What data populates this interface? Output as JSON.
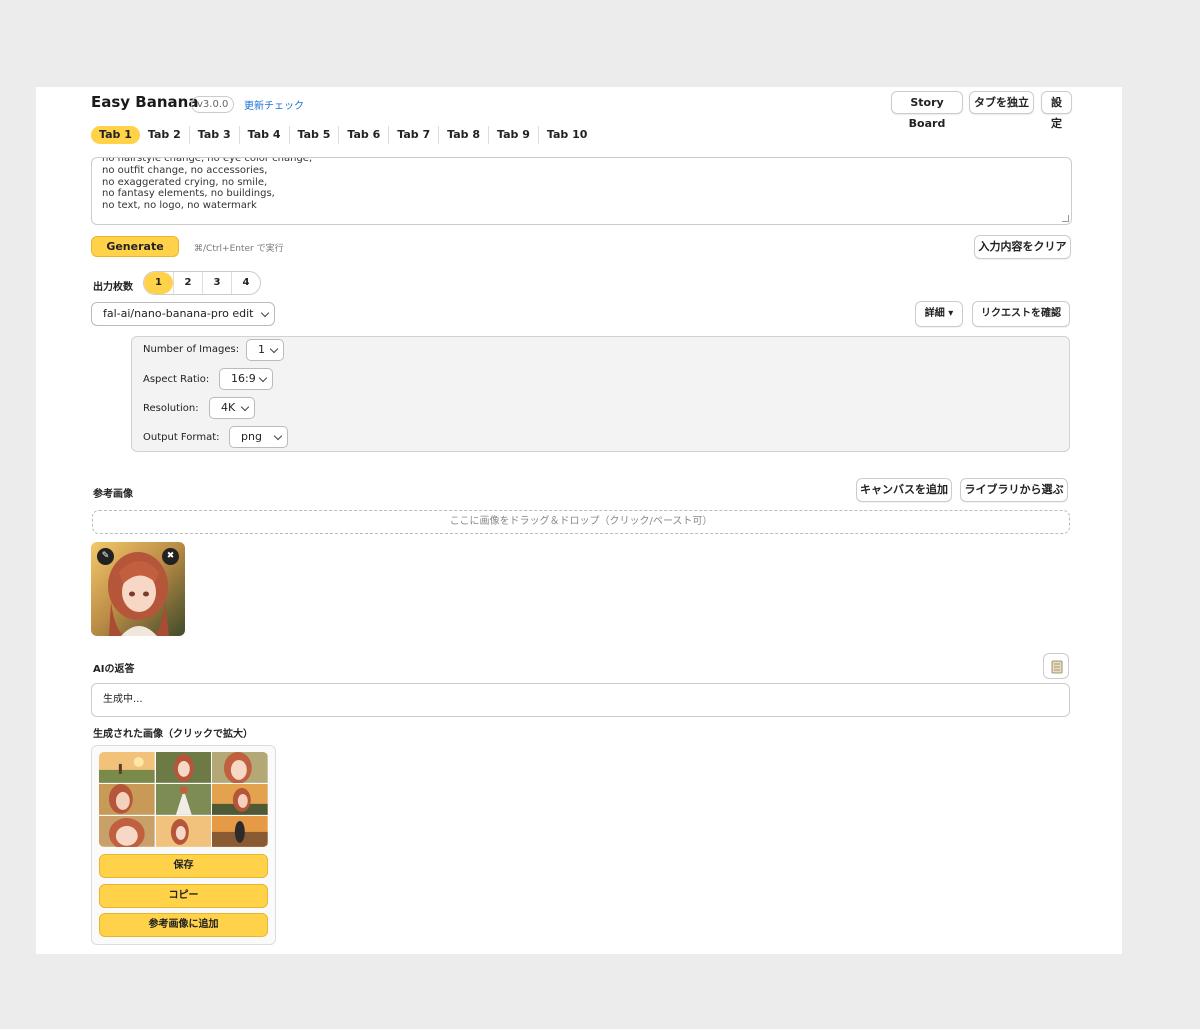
{
  "header": {
    "title": "Easy Banana",
    "version": "v3.0.0",
    "update_check": "更新チェック",
    "story_board": "Story Board",
    "detach_tab": "タブを独立",
    "settings": "設定"
  },
  "tabs": [
    "Tab 1",
    "Tab 2",
    "Tab 3",
    "Tab 4",
    "Tab 5",
    "Tab 6",
    "Tab 7",
    "Tab 8",
    "Tab 9",
    "Tab 10"
  ],
  "prompt": {
    "text": "no hairstyle change, no eye color change,\nno outfit change, no accessories,\nno exaggerated crying, no smile,\nno fantasy elements, no buildings,\nno text, no logo, no watermark"
  },
  "actions": {
    "generate": "Generate",
    "shortcut": "⌘/Ctrl+Enter で実行",
    "clear": "入力内容をクリア"
  },
  "output_count": {
    "label": "出力枚数",
    "options": [
      "1",
      "2",
      "3",
      "4"
    ],
    "selected": "1"
  },
  "model": {
    "selected": "fal-ai/nano-banana-pro edit",
    "detail": "詳細 ▾",
    "check_request": "リクエストを確認"
  },
  "params": {
    "num_images": {
      "label": "Number of Images:",
      "value": "1"
    },
    "aspect_ratio": {
      "label": "Aspect Ratio:",
      "value": "16:9"
    },
    "resolution": {
      "label": "Resolution:",
      "value": "4K"
    },
    "output_format": {
      "label": "Output Format:",
      "value": "png"
    }
  },
  "reference": {
    "label": "参考画像",
    "add_canvas": "キャンバスを追加",
    "from_library": "ライブラリから選ぶ",
    "dropzone": "ここに画像をドラッグ＆ドロップ（クリック/ペースト可）",
    "edit_icon": "✎",
    "remove_icon": "✖"
  },
  "ai_response": {
    "label": "AIの返答",
    "text": "生成中..."
  },
  "generated": {
    "label": "生成された画像（クリックで拡大）",
    "save": "保存",
    "copy": "コピー",
    "add_to_reference": "参考画像に追加"
  }
}
